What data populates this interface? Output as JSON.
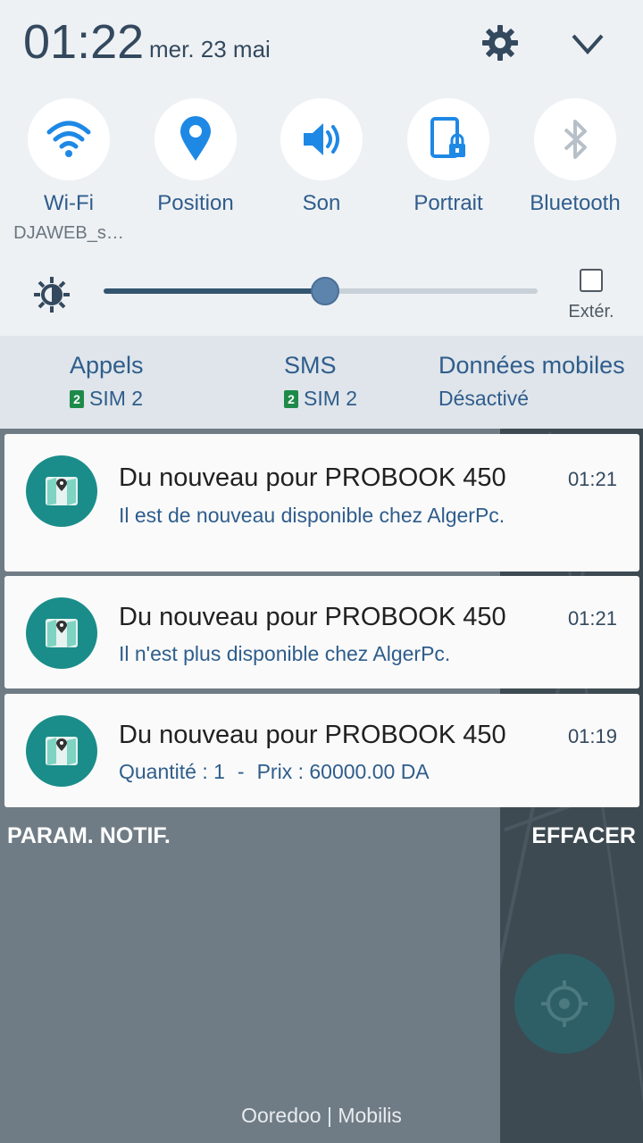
{
  "status": {
    "time": "01:22",
    "date": "mer. 23 mai"
  },
  "toggles": [
    {
      "label": "Wi-Fi",
      "sub": "DJAWEB_s…",
      "icon": "wifi-icon"
    },
    {
      "label": "Position",
      "sub": "",
      "icon": "location-icon"
    },
    {
      "label": "Son",
      "sub": "",
      "icon": "volume-icon"
    },
    {
      "label": "Portrait",
      "sub": "",
      "icon": "portrait-lock-icon"
    },
    {
      "label": "Bluetooth",
      "sub": "",
      "icon": "bluetooth-icon"
    }
  ],
  "brightness": {
    "level": 0.51,
    "outdoor_label": "Extér."
  },
  "sim": {
    "calls": {
      "label": "Appels",
      "sim_badge": "2",
      "sim": "SIM 2"
    },
    "sms": {
      "label": "SMS",
      "sim_badge": "2",
      "sim": "SIM 2"
    },
    "data": {
      "label": "Données mobiles",
      "status": "Désactivé"
    }
  },
  "notifications": [
    {
      "title": "Du nouveau pour PROBOOK 450",
      "time": "01:21",
      "body": "Il est de nouveau disponible chez AlgerPc."
    },
    {
      "title": "Du nouveau pour PROBOOK 450",
      "time": "01:21",
      "body": "Il n'est plus disponible chez AlgerPc."
    },
    {
      "title": "Du nouveau pour PROBOOK 450",
      "time": "01:19",
      "body_qty": "Quantité : 1",
      "body_sep": "-",
      "body_price": "Prix : 60000.00 DA"
    }
  ],
  "actions": {
    "settings": "PARAM. NOTIF.",
    "clear": "EFFACER"
  },
  "carrier": "Ooredoo | Mobilis",
  "colors": {
    "accent": "#2f5d8c",
    "icon_teal": "#1a8d8a",
    "panel": "#eef1f4",
    "sim_green": "#1e8a4a"
  }
}
